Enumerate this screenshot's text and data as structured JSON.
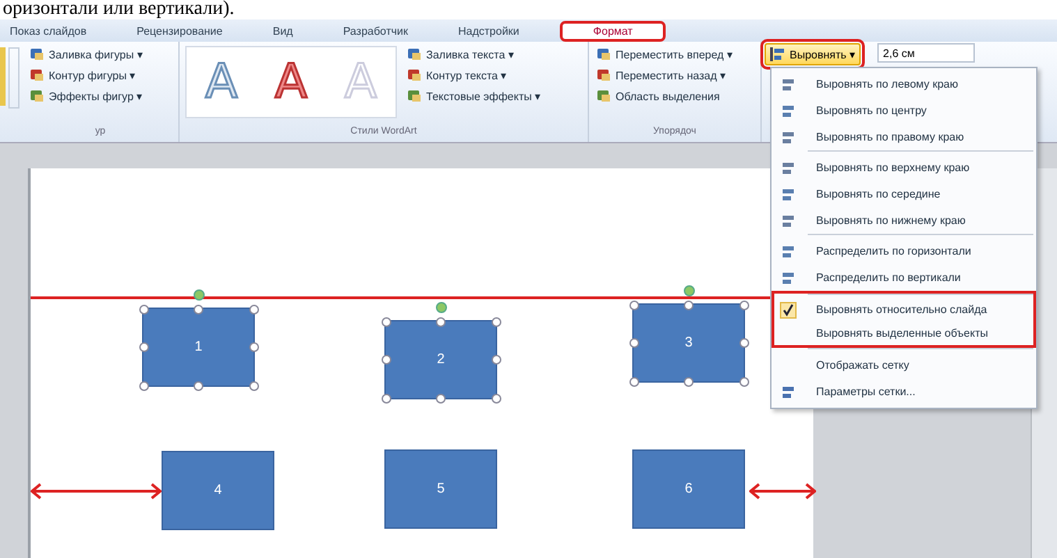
{
  "caption_fragment": "оризонтали или вертикали).",
  "tabs": [
    {
      "label": "Показ слайдов",
      "selected": false,
      "highlighted": false
    },
    {
      "label": "Рецензирование",
      "selected": false,
      "highlighted": false
    },
    {
      "label": "Вид",
      "selected": false,
      "highlighted": false
    },
    {
      "label": "Разработчик",
      "selected": false,
      "highlighted": false
    },
    {
      "label": "Надстройки",
      "selected": false,
      "highlighted": false
    },
    {
      "label": "Формат",
      "selected": true,
      "highlighted": true
    }
  ],
  "ribbon": {
    "wordart_samples": [
      "A",
      "A",
      "A"
    ],
    "groups": [
      {
        "label": "ур",
        "buttons": [
          "Заливка фигуры ▾",
          "Контур фигуры ▾",
          "Эффекты фигур ▾"
        ]
      },
      {
        "label": "Стили WordArt",
        "buttons": [
          "Заливка текста ▾",
          "Контур текста ▾",
          "Текстовые эффекты ▾"
        ]
      },
      {
        "label": "Упорядоч",
        "buttons": [
          "Переместить вперед ▾",
          "Переместить назад ▾",
          "Область выделения"
        ]
      }
    ],
    "align_button": {
      "label": "Выровнять ▾",
      "highlighted": true
    },
    "size_field": {
      "value": "2,6 см"
    }
  },
  "align_menu": [
    {
      "label": "Выровнять по левому краю",
      "checked": false,
      "highlighted": false,
      "separator_before": false
    },
    {
      "label": "Выровнять по центру",
      "checked": false,
      "highlighted": false,
      "separator_before": false
    },
    {
      "label": "Выровнять по правому краю",
      "checked": false,
      "highlighted": false,
      "separator_before": false
    },
    {
      "label": "Выровнять по верхнему краю",
      "checked": false,
      "highlighted": false,
      "separator_before": true
    },
    {
      "label": "Выровнять по середине",
      "checked": false,
      "highlighted": false,
      "separator_before": false
    },
    {
      "label": "Выровнять по нижнему краю",
      "checked": false,
      "highlighted": false,
      "separator_before": false
    },
    {
      "label": "Распределить по горизонтали",
      "checked": false,
      "highlighted": false,
      "separator_before": true
    },
    {
      "label": "Распределить по вертикали",
      "checked": false,
      "highlighted": false,
      "separator_before": false
    },
    {
      "label": "Выровнять относительно слайда",
      "checked": true,
      "highlighted": true,
      "separator_before": true
    },
    {
      "label": "Выровнять выделенные объекты",
      "checked": false,
      "highlighted": true,
      "separator_before": false
    },
    {
      "label": "Отображать сетку",
      "checked": false,
      "highlighted": false,
      "separator_before": true
    },
    {
      "label": "Параметры сетки...",
      "checked": false,
      "highlighted": false,
      "separator_before": false
    }
  ],
  "slide": {
    "shapes": [
      {
        "label": "1",
        "selected": true
      },
      {
        "label": "2",
        "selected": true
      },
      {
        "label": "3",
        "selected": true
      },
      {
        "label": "4",
        "selected": false
      },
      {
        "label": "5",
        "selected": false
      },
      {
        "label": "6",
        "selected": false
      }
    ]
  }
}
